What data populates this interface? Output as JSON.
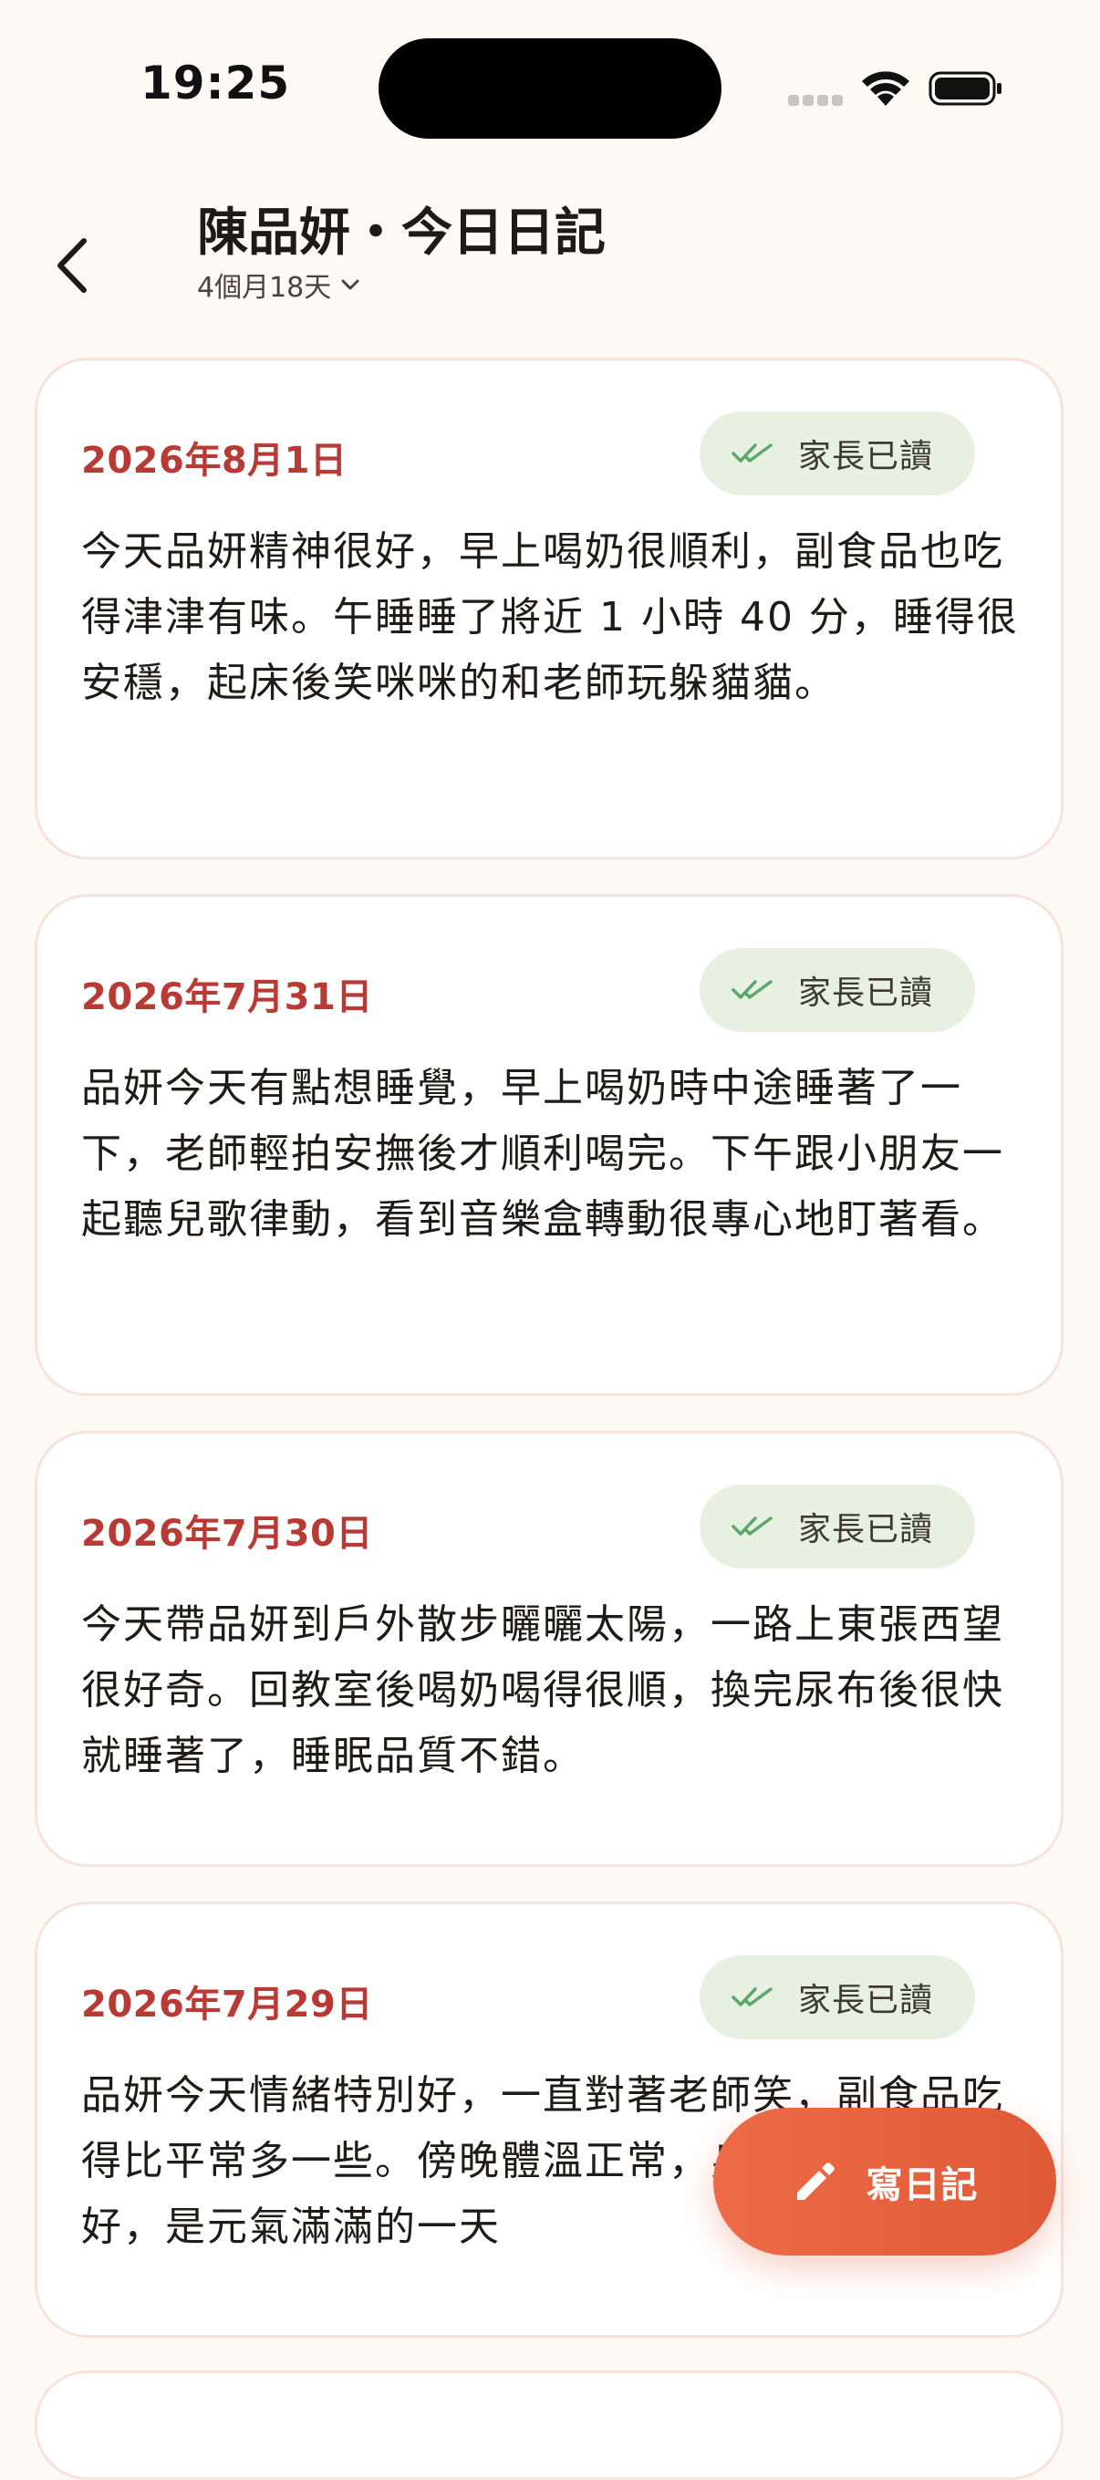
{
  "status_bar": {
    "time": "19:25"
  },
  "header": {
    "title": "陳品妍・今日日記",
    "subtitle": "4個月18天"
  },
  "entries": [
    {
      "date": "2026年8月1日",
      "status": "家長已讀",
      "text": "今天品妍精神很好，早上喝奶很順利，副食品也吃得津津有味。午睡睡了將近 1 小時 40 分，睡得很安穩，起床後笑咪咪的和老師玩躲貓貓。"
    },
    {
      "date": "2026年7月31日",
      "status": "家長已讀",
      "text": "品妍今天有點想睡覺，早上喝奶時中途睡著了一下，老師輕拍安撫後才順利喝完。下午跟小朋友一起聽兒歌律動，看到音樂盒轉動很專心地盯著看。"
    },
    {
      "date": "2026年7月30日",
      "status": "家長已讀",
      "text": "今天帶品妍到戶外散步曬曬太陽，一路上東張西望很好奇。回教室後喝奶喝得很順，換完尿布後很快就睡著了，睡眠品質不錯。"
    },
    {
      "date": "2026年7月29日",
      "status": "家長已讀",
      "text": "品妍今天情緒特別好，一直對著老師笑，副食品吃得比平常多一些。傍晚體溫正常，身體活動力很好，是元氣滿滿的一天"
    }
  ],
  "fab": {
    "label": "寫日記",
    "icon": "pencil-icon"
  },
  "colors": {
    "background": "#fdf9f4",
    "date_red": "#b73a34",
    "badge_green": "#e8f0e1",
    "check_green": "#5aa86a",
    "fab_orange": "#e6603d"
  }
}
